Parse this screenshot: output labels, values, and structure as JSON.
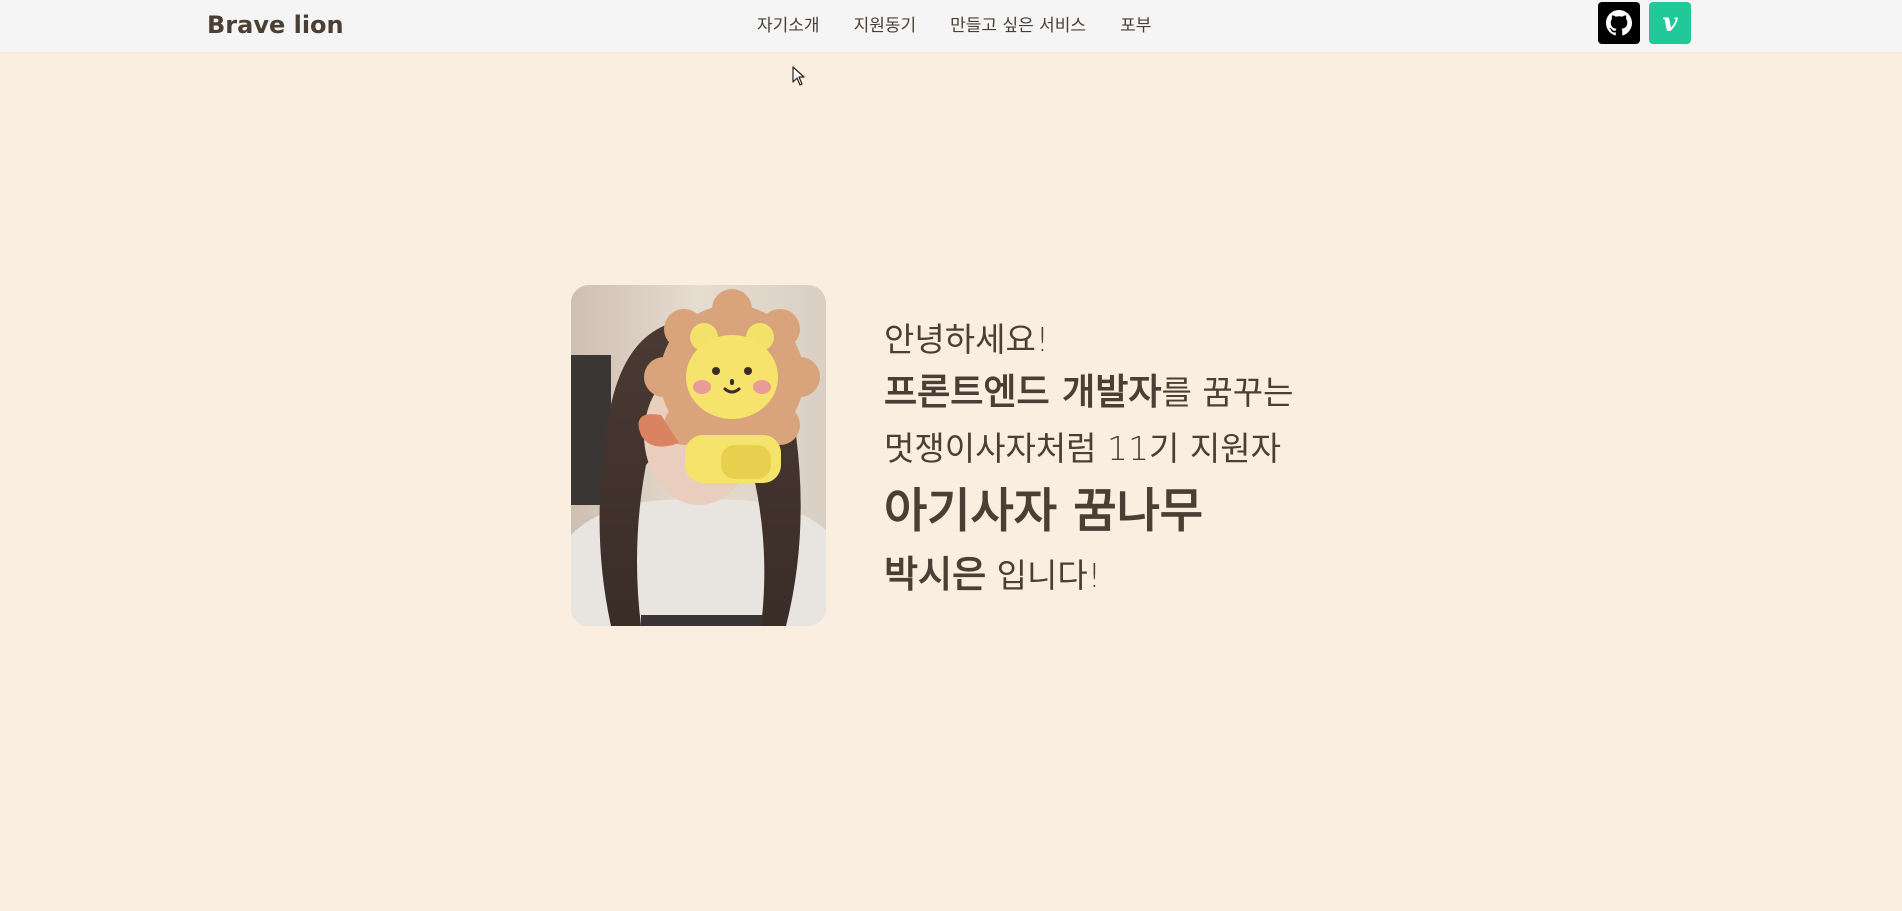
{
  "header": {
    "brand": "Brave lion",
    "nav": [
      "자기소개",
      "지원동기",
      "만들고 싶은 서비스",
      "포부"
    ],
    "social": {
      "github_icon": "github-icon",
      "velog_icon": "velog-icon",
      "velog_letter": "v",
      "github_color": "#000000",
      "velog_color": "#20c997"
    }
  },
  "hero": {
    "photo_icon": "profile-photo-with-lion-sticker",
    "greeting": "안녕하세요!",
    "dream_strong": "프론트엔드 개발자",
    "dream_rest": "를 꿈꾸는",
    "org_line": "멋쟁이사자처럼 11기 지원자",
    "nickname": "아기사자 꿈나무",
    "name_strong": "박시은",
    "name_rest": " 입니다!"
  },
  "colors": {
    "background": "#faeee0",
    "navbar": "#f5f5f5",
    "text": "#4a3f35"
  }
}
